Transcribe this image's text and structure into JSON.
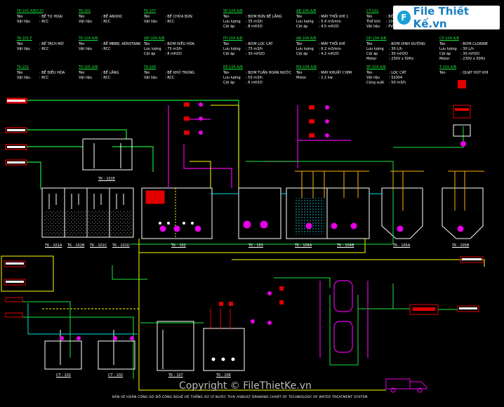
{
  "header": {
    "spec_blocks": [
      {
        "id": "TK-101 A/B/C/D",
        "rows": [
          [
            "Tên",
            ": BỂ TỰ HOẠI"
          ],
          [
            "Vật liệu",
            ": RCC"
          ]
        ]
      },
      {
        "id": "TK-101",
        "rows": [
          [
            "Tên",
            ": BỂ ANOXIC"
          ],
          [
            "Vật liệu",
            ": RCC"
          ]
        ]
      },
      {
        "id": "TK-107",
        "rows": [
          [
            "Tên",
            ": BỂ CHỨA BÙN"
          ],
          [
            "Vật liệu",
            ": RCC"
          ]
        ]
      },
      {
        "id": "SP-104 A/B",
        "rows": [
          [
            "Tên",
            ": BƠM BÙN BỂ LẮNG"
          ],
          [
            "Lưu lượng",
            ": 35 m3/h"
          ],
          [
            "Cột áp",
            ": 8 mH2O"
          ]
        ]
      },
      {
        "id": "AB-104 A/B",
        "rows": [
          [
            "Tên",
            ": MÁY THỔI KHÍ 1"
          ],
          [
            "Lưu lượng",
            ": 5.4 m3/min"
          ],
          [
            "Cột áp",
            ": 4.5 mH2O"
          ]
        ]
      },
      {
        "id": "CT-101",
        "rows": [
          [
            "Tên",
            ": BỒN CHỨA"
          ],
          [
            "Thể tích",
            ": 1000L"
          ],
          [
            "Vật liệu",
            ": PVC"
          ]
        ]
      },
      {
        "id": "TK-101 F",
        "rows": [
          [
            "Tên",
            ": BỂ TÁCH MỠ"
          ],
          [
            "Vật liệu",
            ": RCC"
          ]
        ]
      },
      {
        "id": "TK-104 A/B",
        "rows": [
          [
            "Tên",
            ": BỂ MBBR, AEROTANK"
          ],
          [
            "Vật liệu",
            ": RCC"
          ]
        ]
      },
      {
        "id": "WP-104 A/B",
        "rows": [
          [
            "Tên",
            ": BƠM ĐIỀU HÒA"
          ],
          [
            "Lưu lượng",
            ": 75 m3/h"
          ],
          [
            "Cột áp",
            ": 8 mH2O"
          ]
        ]
      },
      {
        "id": "FP-104 A/B",
        "rows": [
          [
            "Tên",
            ": BƠM LỌC CÁT"
          ],
          [
            "Lưu lượng",
            ": 75 m3/h"
          ],
          [
            "Cột áp",
            ": 30 mH2O"
          ]
        ]
      },
      {
        "id": "AB-104 A/B",
        "rows": [
          [
            "Tên",
            ": MÁY THỔI KHÍ"
          ],
          [
            "Lưu lượng",
            ": 6.2 m3/min"
          ],
          [
            "Cột áp",
            ": 4.2 mH2O"
          ]
        ]
      },
      {
        "id": "DP-104 A/B",
        "rows": [
          [
            "Tên",
            ": BƠM DINH DƯỠNG"
          ],
          [
            "Lưu lượng",
            ": 30 L/h"
          ],
          [
            "Cột áp",
            ": 30 mH2O"
          ],
          [
            "Motor",
            ": 230V x 50Hz"
          ]
        ]
      },
      {
        "id": "CP-104 A/B",
        "rows": [
          [
            "Tên",
            ": BƠM CLORINE"
          ],
          [
            "Lưu lượng",
            ": 30 L/h"
          ],
          [
            "Cột áp",
            ": 30 mH2O"
          ],
          [
            "Motor",
            ": 230V x 50Hz"
          ]
        ]
      },
      {
        "id": "TK-101",
        "rows": [
          [
            "Tên",
            ": BỂ ĐIỀU HÒA"
          ],
          [
            "Vật liệu",
            ": RCC"
          ]
        ]
      },
      {
        "id": "TK-105 A/B",
        "rows": [
          [
            "Tên",
            ": BỂ LẮNG"
          ],
          [
            "Vật liệu",
            ": RCC"
          ]
        ]
      },
      {
        "id": "TK-106",
        "rows": [
          [
            "Tên",
            ": BỂ KHỬ TRÙNG"
          ],
          [
            "Vật liệu",
            ": RCC"
          ]
        ]
      },
      {
        "id": "RP-104 A/B",
        "rows": [
          [
            "Tên",
            ": BƠM TUẦN HOÀN NƯỚC"
          ],
          [
            "Lưu lượng",
            ": 50 m3/h"
          ],
          [
            "Cột áp",
            ": 6 mH2O"
          ]
        ]
      },
      {
        "id": "MX-104 A/B",
        "rows": [
          [
            "Tên",
            ": MÁY KHUẤY CHÌM"
          ],
          [
            "Motor",
            ": 2.2 kw"
          ]
        ]
      },
      {
        "id": "SF-104 A/B",
        "rows": [
          [
            "Tên",
            ": LỌC CÁT"
          ],
          [
            "Vật liệu",
            ": SS304"
          ],
          [
            "Công suất",
            ": 50 m3/h"
          ]
        ]
      },
      {
        "id": "T-101 A/B",
        "rows": [
          [
            "Tên",
            ": QUẠT HÚT KHÍ"
          ]
        ]
      }
    ]
  },
  "tank_labels": {
    "tk101a": "TK - 101A",
    "tk101b": "TK - 101B",
    "tk101c": "TK - 101C",
    "tk101d": "TK - 101D",
    "tk101e": "TK - 101E",
    "tk102": "TK - 102",
    "tk103": "TK - 103",
    "tk104a": "TK - 104A",
    "tk104b": "TK - 104B",
    "tk105a": "TK - 105A",
    "tk105b": "TK - 105B",
    "tk107": "TK - 107",
    "tk106": "TK - 106",
    "ct101": "CT - 101",
    "ct102": "CT - 102"
  },
  "logo": {
    "mark": "F",
    "text": "File Thiết Kế.vn"
  },
  "footer": {
    "copyright": "Copyright © FileThietKe.vn",
    "caption": "BẢN VẼ HOÀN CÔNG SƠ ĐỒ CÔNG NGHỆ HỆ THỐNG XỬ LÝ NƯỚC THẢI  ASBUILT DRAWING CHART OF TECHNOLOGY OF WATER TREATMENT SYSTEM"
  },
  "colors": {
    "water": "#19e63b",
    "air": "#ffb000",
    "chemical": "#e600e6",
    "sludge": "#ffff00",
    "recycle": "#00e0e0",
    "tank": "#ffffff",
    "red": "#e00000"
  }
}
